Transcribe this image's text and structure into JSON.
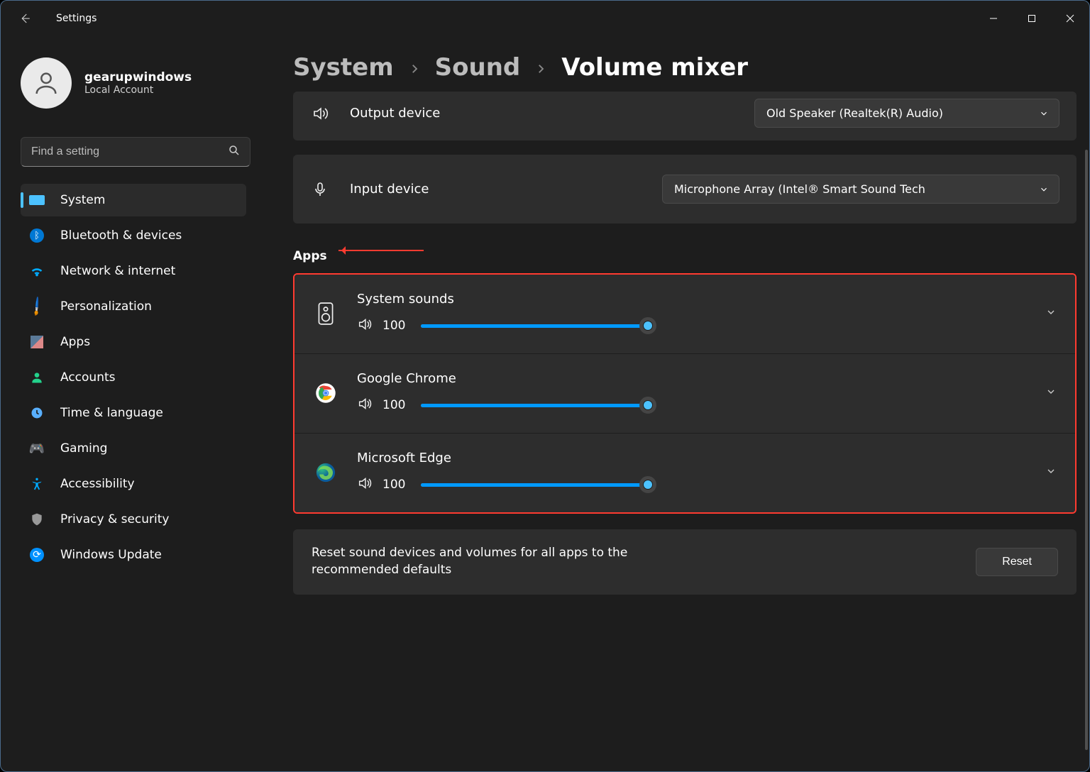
{
  "window": {
    "app_title": "Settings"
  },
  "profile": {
    "name": "gearupwindows",
    "subtitle": "Local Account"
  },
  "search": {
    "placeholder": "Find a setting"
  },
  "nav": {
    "items": [
      {
        "label": "System",
        "active": true
      },
      {
        "label": "Bluetooth & devices"
      },
      {
        "label": "Network & internet"
      },
      {
        "label": "Personalization"
      },
      {
        "label": "Apps"
      },
      {
        "label": "Accounts"
      },
      {
        "label": "Time & language"
      },
      {
        "label": "Gaming"
      },
      {
        "label": "Accessibility"
      },
      {
        "label": "Privacy & security"
      },
      {
        "label": "Windows Update"
      }
    ]
  },
  "breadcrumb": {
    "a": "System",
    "b": "Sound",
    "c": "Volume mixer"
  },
  "devices": {
    "output_label": "Output device",
    "output_value": "Old Speaker (Realtek(R) Audio)",
    "input_label": "Input device",
    "input_value": "Microphone Array (Intel® Smart Sound Tech"
  },
  "apps_section": {
    "title": "Apps",
    "items": [
      {
        "name": "System sounds",
        "volume": 100
      },
      {
        "name": "Google Chrome",
        "volume": 100
      },
      {
        "name": "Microsoft Edge",
        "volume": 100
      }
    ]
  },
  "reset": {
    "text": "Reset sound devices and volumes for all apps to the recommended defaults",
    "button": "Reset"
  }
}
